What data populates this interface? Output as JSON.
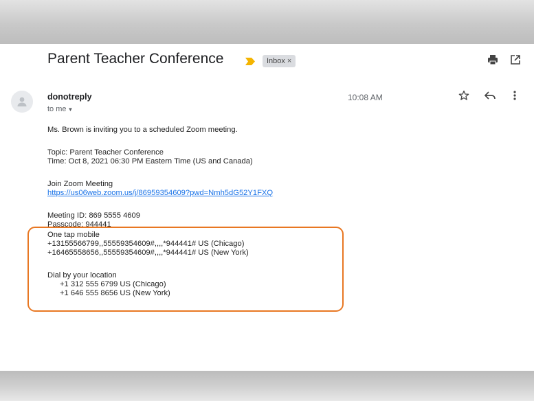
{
  "email": {
    "subject": "Parent Teacher Conference",
    "label": "Inbox",
    "label_close": "×",
    "sender": "donotreply",
    "recipient": "to me",
    "time": "10:08 AM",
    "body": {
      "intro": "Ms. Brown is inviting you to a scheduled Zoom meeting.",
      "topic": "Topic: Parent Teacher Conference",
      "time_line": "Time: Oct 8, 2021 06:30 PM Eastern Time (US and Canada)",
      "join_label": "Join Zoom Meeting",
      "join_link": "https://us06web.zoom.us/j/86959354609?pwd=Nmh5dG52Y1FXQ",
      "meeting_id": "Meeting ID: 869 5555 4609",
      "passcode": "Passcode: 944441",
      "one_tap_heading": "One tap mobile",
      "one_tap_1": "+13155566799,,55559354609#,,,,*944441# US (Chicago)",
      "one_tap_2": "+16465558656,,55559354609#,,,,*944441# US (New York)",
      "dial_heading": "Dial by your location",
      "dial_1": "+1 312 555 6799 US (Chicago)",
      "dial_2": "+1 646 555 8656 US (New York)"
    }
  },
  "icons": {
    "print": "print-icon",
    "open_new_window": "open-in-new-icon",
    "important": "important-marker-icon",
    "avatar": "person-icon",
    "star": "star-icon",
    "reply": "reply-icon",
    "more": "more-vert-icon"
  },
  "colors": {
    "highlight": "#e87722",
    "link": "#1a73e8",
    "important": "#f4b400"
  }
}
